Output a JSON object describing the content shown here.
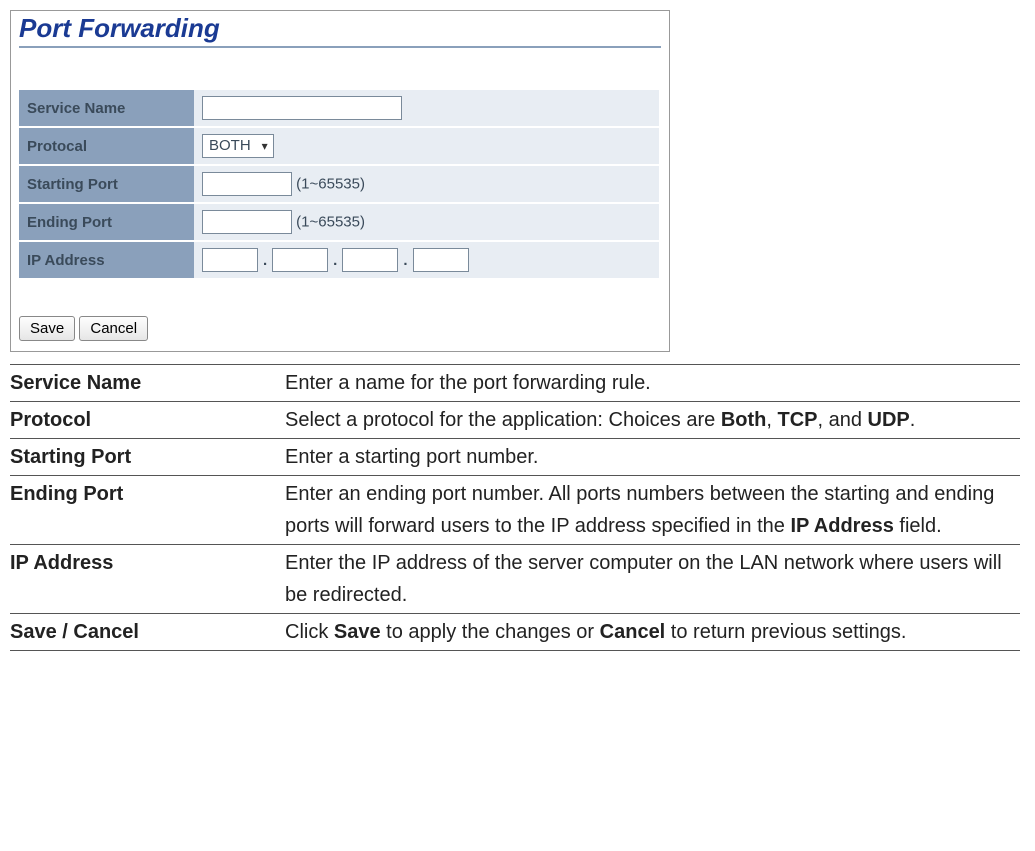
{
  "screenshot": {
    "title": "Port Forwarding",
    "rows": {
      "servicename_label": "Service Name",
      "protocol_label": "Protocal",
      "protocol_value": "BOTH",
      "starting_port_label": "Starting Port",
      "starting_port_hint": "(1~65535)",
      "ending_port_label": "Ending Port",
      "ending_port_hint": "(1~65535)",
      "ip_address_label": "IP Address",
      "ip_dot": "."
    },
    "buttons": {
      "save": "Save",
      "cancel": "Cancel"
    }
  },
  "descriptions": [
    {
      "term": "Service Name",
      "desc": "Enter a name for the port forwarding rule."
    },
    {
      "term": "Protocol",
      "desc": "Select a protocol for the application: Choices are <b>Both</b>, <b>TCP</b>, and <b>UDP</b>."
    },
    {
      "term": "Starting Port",
      "desc": "Enter a starting port number."
    },
    {
      "term": "Ending Port",
      "desc": "Enter an ending port number. All ports numbers between the starting and ending ports will forward users to the IP address specified in the <b>IP Address</b> field."
    },
    {
      "term": "IP Address",
      "desc": "Enter the IP address of the server computer on the LAN network where users will be redirected."
    },
    {
      "term": "Save / Cancel",
      "desc": "Click <b>Save</b> to apply the changes or <b>Cancel</b> to return previous settings."
    }
  ]
}
